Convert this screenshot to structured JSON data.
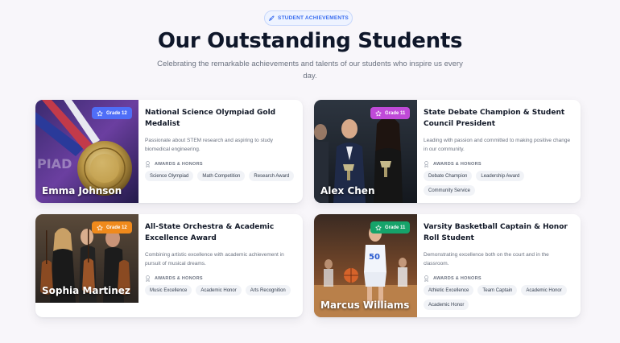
{
  "header": {
    "pill_label": "STUDENT ACHIEVEMENTS",
    "title": "Our Outstanding Students",
    "subtitle": "Celebrating the remarkable achievements and talents of our students who inspire us every day."
  },
  "awards_heading": "AWARDS & HONORS",
  "students": [
    {
      "name": "Emma Johnson",
      "grade": "Grade 12",
      "grade_color": "#4f6ef7",
      "title": "National Science Olympiad Gold Medalist",
      "description": "Passionate about STEM research and aspiring to study biomedical engineering.",
      "tags": [
        "Science Olympiad",
        "Math Competition",
        "Research Award"
      ]
    },
    {
      "name": "Alex Chen",
      "grade": "Grade 11",
      "grade_color": "#c04ad8",
      "title": "State Debate Champion & Student Council President",
      "description": "Leading with passion and committed to making positive change in our community.",
      "tags": [
        "Debate Champion",
        "Leadership Award",
        "Community Service"
      ]
    },
    {
      "name": "Sophia Martinez",
      "grade": "Grade 12",
      "grade_color": "#f08a1c",
      "title": "All-State Orchestra & Academic Excellence Award",
      "description": "Combining artistic excellence with academic achievement in pursuit of musical dreams.",
      "tags": [
        "Music Excellence",
        "Academic Honor",
        "Arts Recognition"
      ]
    },
    {
      "name": "Marcus Williams",
      "grade": "Grade 11",
      "grade_color": "#16a36a",
      "title": "Varsity Basketball Captain & Honor Roll Student",
      "description": "Demonstrating excellence both on the court and in the classroom.",
      "tags": [
        "Athletic Excellence",
        "Team Captain",
        "Academic Honor",
        "Academic Honor"
      ]
    }
  ]
}
